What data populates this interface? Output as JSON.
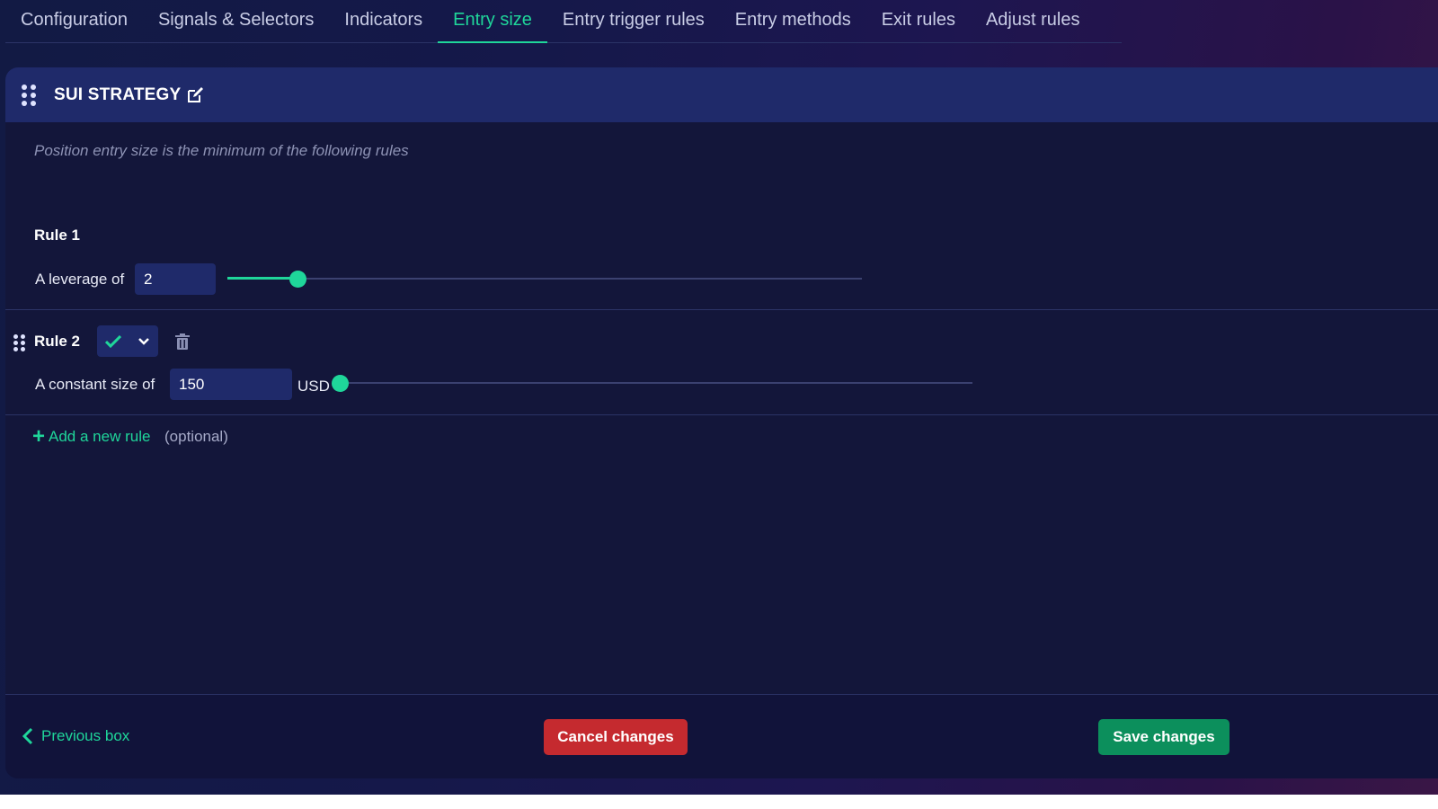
{
  "tabs": [
    {
      "label": "Configuration",
      "active": false
    },
    {
      "label": "Signals & Selectors",
      "active": false
    },
    {
      "label": "Indicators",
      "active": false
    },
    {
      "label": "Entry size",
      "active": true
    },
    {
      "label": "Entry trigger rules",
      "active": false
    },
    {
      "label": "Entry methods",
      "active": false
    },
    {
      "label": "Exit rules",
      "active": false
    },
    {
      "label": "Adjust rules",
      "active": false
    }
  ],
  "panel": {
    "title": "SUI STRATEGY",
    "hint": "Position entry size is the minimum of the following rules"
  },
  "rule1": {
    "title": "Rule 1",
    "label": "A leverage of",
    "value": "2",
    "slider_fraction": 0.11
  },
  "rule2": {
    "title": "Rule 2",
    "label": "A constant size of",
    "value": "150",
    "unit": "USD",
    "slider_fraction": 0.0,
    "status_icon": "check-icon",
    "delete_icon": "trash-icon"
  },
  "add_rule": {
    "label": "Add a new rule",
    "optional": "(optional)"
  },
  "footer": {
    "previous_label": "Previous box",
    "cancel_label": "Cancel changes",
    "save_label": "Save changes"
  },
  "colors": {
    "accent": "#1fd69a",
    "header_bg": "#1f2a6a",
    "panel_bg": "#13163a",
    "cancel_bg": "#c52a2f",
    "save_bg": "#0c8f5c"
  }
}
